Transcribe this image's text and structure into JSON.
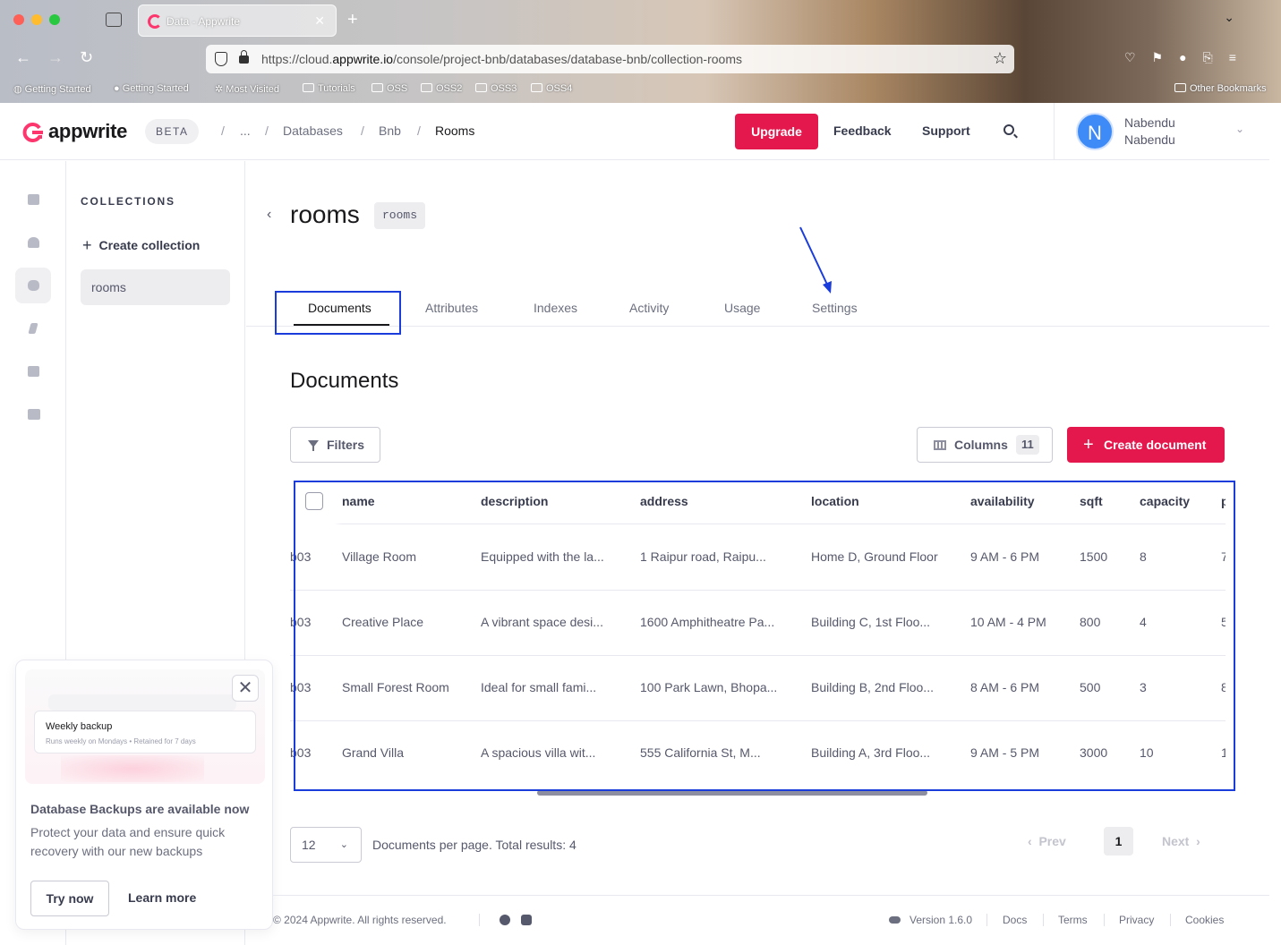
{
  "browser": {
    "tab_title": "Data - Appwrite",
    "url_prefix": "https://cloud.",
    "url_domain": "appwrite.io",
    "url_path": "/console/project-bnb/databases/database-bnb/collection-rooms",
    "bookmarks": [
      "Getting Started",
      "Getting Started",
      "Most Visited",
      "Tutorials",
      "OSS",
      "OSS2",
      "OSS3",
      "OSS4"
    ],
    "other_bookmarks": "Other Bookmarks"
  },
  "header": {
    "logo_text": "appwrite",
    "beta": "BETA",
    "breadcrumbs": [
      "...",
      "Databases",
      "Bnb",
      "Rooms"
    ],
    "upgrade": "Upgrade",
    "feedback": "Feedback",
    "support": "Support",
    "user": {
      "initial": "N",
      "name": "Nabendu",
      "email": "Nabendu"
    }
  },
  "sidebar": {
    "title": "COLLECTIONS",
    "create": "Create collection",
    "items": [
      "rooms"
    ]
  },
  "promo": {
    "card_title": "Weekly backup",
    "card_sub": "Runs weekly on Mondays  •  Retained for 7 days",
    "heading": "Database Backups are available now",
    "body": "Protect your data and ensure quick recovery with our new backups",
    "try": "Try now",
    "learn": "Learn more"
  },
  "collection": {
    "name": "rooms",
    "id": "rooms",
    "tabs": [
      "Documents",
      "Attributes",
      "Indexes",
      "Activity",
      "Usage",
      "Settings"
    ],
    "active_tab": "Documents"
  },
  "documents": {
    "heading": "Documents",
    "filters": "Filters",
    "columns_label": "Columns",
    "columns_count": "11",
    "create": "Create document",
    "columns": [
      "name",
      "description",
      "address",
      "location",
      "availability",
      "sqft",
      "capacity",
      "p"
    ],
    "rows": [
      {
        "id": "b03",
        "name": "Village Room",
        "description": "Equipped with the la...",
        "address": "1 Raipur road, Raipu...",
        "location": "Home D, Ground Floor",
        "availability": "9 AM - 6 PM",
        "sqft": "1500",
        "capacity": "8",
        "p": "7"
      },
      {
        "id": "b03",
        "name": "Creative Place",
        "description": "A vibrant space desi...",
        "address": "1600 Amphitheatre Pa...",
        "location": "Building C, 1st Floo...",
        "availability": "10 AM - 4 PM",
        "sqft": "800",
        "capacity": "4",
        "p": "5"
      },
      {
        "id": "b03",
        "name": "Small Forest Room",
        "description": "Ideal for small fami...",
        "address": "100 Park Lawn, Bhopa...",
        "location": "Building B, 2nd Floo...",
        "availability": "8 AM - 6 PM",
        "sqft": "500",
        "capacity": "3",
        "p": "8"
      },
      {
        "id": "b03",
        "name": "Grand Villa",
        "description": "A spacious villa wit...",
        "address": "555 California St, M...",
        "location": "Building A, 3rd Floo...",
        "availability": "9 AM - 5 PM",
        "sqft": "3000",
        "capacity": "10",
        "p": "1"
      }
    ]
  },
  "pagination": {
    "per_page": "12",
    "summary": "Documents per page. Total results: 4",
    "prev": "Prev",
    "page": "1",
    "next": "Next"
  },
  "footer": {
    "copyright": "© 2024 Appwrite. All rights reserved.",
    "version": "Version 1.6.0",
    "links": [
      "Docs",
      "Terms",
      "Privacy",
      "Cookies"
    ]
  },
  "colors": {
    "brand": "#e4184c",
    "annotation": "#1a3cdb"
  }
}
